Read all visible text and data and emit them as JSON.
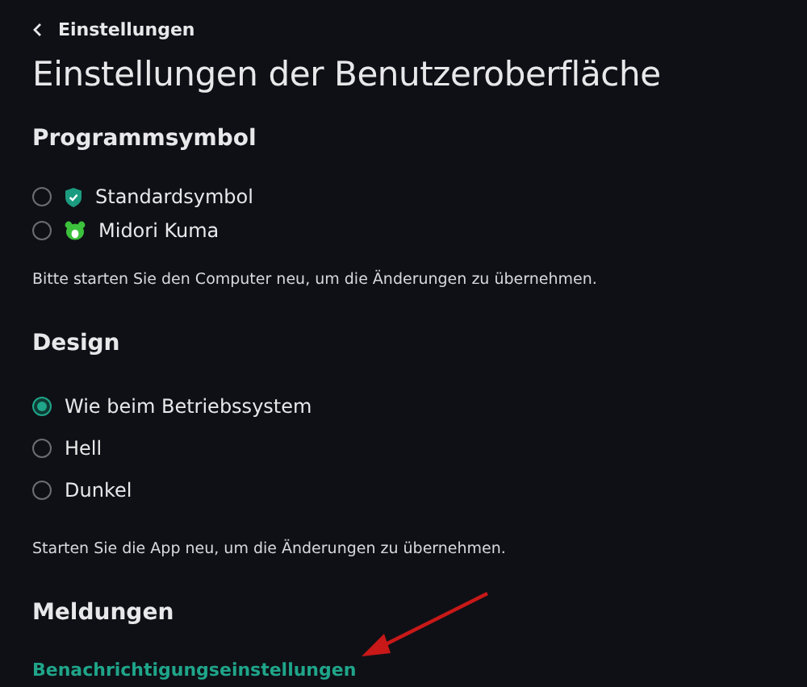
{
  "back": {
    "label": "Einstellungen"
  },
  "title": "Einstellungen der Benutzeroberfläche",
  "sections": [
    {
      "heading": "Programmsymbol",
      "options": [
        {
          "label": "Standardsymbol",
          "selected": false,
          "kind": "shield"
        },
        {
          "label": "Midori Kuma",
          "selected": false,
          "kind": "bear"
        }
      ],
      "note": "Bitte starten Sie den Computer neu, um die Änderungen zu übernehmen."
    },
    {
      "heading": "Design",
      "options": [
        {
          "label": "Wie beim Betriebssystem",
          "selected": true,
          "kind": "plain"
        },
        {
          "label": "Hell",
          "selected": false,
          "kind": "plain"
        },
        {
          "label": "Dunkel",
          "selected": false,
          "kind": "plain"
        }
      ],
      "note": "Starten Sie die App neu, um die Änderungen zu übernehmen."
    },
    {
      "heading": "Meldungen",
      "link": "Benachrichtigungseinstellungen"
    }
  ]
}
